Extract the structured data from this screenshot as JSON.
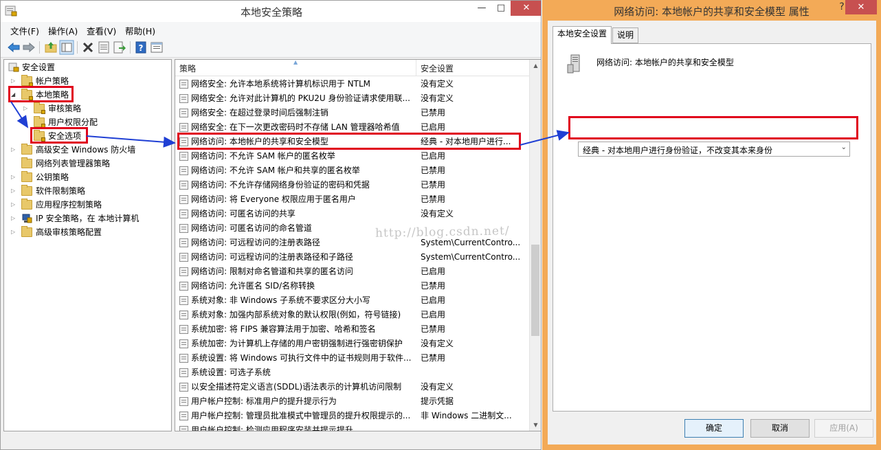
{
  "main_window": {
    "title": "本地安全策略",
    "controls": {
      "minimize": "—",
      "maximize": "□",
      "close": "✕"
    }
  },
  "menu": [
    "文件(F)",
    "操作(A)",
    "查看(V)",
    "帮助(H)"
  ],
  "toolbar_icons": [
    "back-arrow-icon",
    "forward-arrow-icon",
    "up-folder-icon",
    "show-tree-icon",
    "delete-icon",
    "properties-icon",
    "export-list-icon",
    "help-icon",
    "view-icon"
  ],
  "tree": {
    "items": [
      {
        "label": "安全设置"
      },
      {
        "label": "帐户策略"
      },
      {
        "label": "本地策略"
      },
      {
        "label": "审核策略"
      },
      {
        "label": "用户权限分配"
      },
      {
        "label": "安全选项"
      },
      {
        "label": "高级安全 Windows 防火墙"
      },
      {
        "label": "网络列表管理器策略"
      },
      {
        "label": "公钥策略"
      },
      {
        "label": "软件限制策略"
      },
      {
        "label": "应用程序控制策略"
      },
      {
        "label": "IP 安全策略，在 本地计算机"
      },
      {
        "label": "高级审核策略配置"
      }
    ]
  },
  "list": {
    "columns": {
      "policy": "策略",
      "setting": "安全设置"
    },
    "rows": [
      {
        "policy": "网络安全: 允许本地系统将计算机标识用于 NTLM",
        "setting": "没有定义"
      },
      {
        "policy": "网络安全: 允许对此计算机的 PKU2U 身份验证请求使用联...",
        "setting": "没有定义"
      },
      {
        "policy": "网络安全: 在超过登录时间后强制注销",
        "setting": "已禁用"
      },
      {
        "policy": "网络安全: 在下一次更改密码时不存储 LAN 管理器哈希值",
        "setting": "已启用"
      },
      {
        "policy": "网络访问: 本地帐户的共享和安全模型",
        "setting": "经典 - 对本地用户进行..."
      },
      {
        "policy": "网络访问: 不允许 SAM 帐户的匿名枚举",
        "setting": "已启用"
      },
      {
        "policy": "网络访问: 不允许 SAM 帐户和共享的匿名枚举",
        "setting": "已禁用"
      },
      {
        "policy": "网络访问: 不允许存储网络身份验证的密码和凭据",
        "setting": "已禁用"
      },
      {
        "policy": "网络访问: 将 Everyone 权限应用于匿名用户",
        "setting": "已禁用"
      },
      {
        "policy": "网络访问: 可匿名访问的共享",
        "setting": "没有定义"
      },
      {
        "policy": "网络访问: 可匿名访问的命名管道",
        "setting": ""
      },
      {
        "policy": "网络访问: 可远程访问的注册表路径",
        "setting": "System\\CurrentContro..."
      },
      {
        "policy": "网络访问: 可远程访问的注册表路径和子路径",
        "setting": "System\\CurrentContro..."
      },
      {
        "policy": "网络访问: 限制对命名管道和共享的匿名访问",
        "setting": "已启用"
      },
      {
        "policy": "网络访问: 允许匿名 SID/名称转换",
        "setting": "已禁用"
      },
      {
        "policy": "系统对象: 非 Windows 子系统不要求区分大小写",
        "setting": "已启用"
      },
      {
        "policy": "系统对象: 加强内部系统对象的默认权限(例如，符号链接)",
        "setting": "已启用"
      },
      {
        "policy": "系统加密: 将 FIPS 兼容算法用于加密、哈希和签名",
        "setting": "已禁用"
      },
      {
        "policy": "系统加密: 为计算机上存储的用户密钥强制进行强密钥保护",
        "setting": "没有定义"
      },
      {
        "policy": "系统设置: 将 Windows 可执行文件中的证书规则用于软件...",
        "setting": "已禁用"
      },
      {
        "policy": "系统设置: 可选子系统",
        "setting": ""
      },
      {
        "policy": "以安全描述符定义语言(SDDL)语法表示的计算机访问限制",
        "setting": "没有定义"
      },
      {
        "policy": "用户帐户控制: 标准用户的提升提示行为",
        "setting": "提示凭据"
      },
      {
        "policy": "用户帐户控制: 管理员批准模式中管理员的提升权限提示的...",
        "setting": "非 Windows 二进制文..."
      },
      {
        "policy": "用户帐户控制: 检测应用程序安装并提示提升",
        "setting": ""
      }
    ]
  },
  "watermark": "http://blog.csdn.net/",
  "dialog": {
    "title": "网络访问: 本地帐户的共享和安全模型 属性",
    "help": "?",
    "close": "✕",
    "tabs": [
      "本地安全设置",
      "说明"
    ],
    "policy_title": "网络访问: 本地帐户的共享和安全模型",
    "combo_value": "经典 - 对本地用户进行身份验证，不改变其本来身份",
    "buttons": {
      "ok": "确定",
      "cancel": "取消",
      "apply": "应用(A)"
    }
  },
  "colors": {
    "highlight_border": "#e0001b",
    "annotation_arrow": "#1f3fd4",
    "dialog_frame": "#f3aa57"
  }
}
